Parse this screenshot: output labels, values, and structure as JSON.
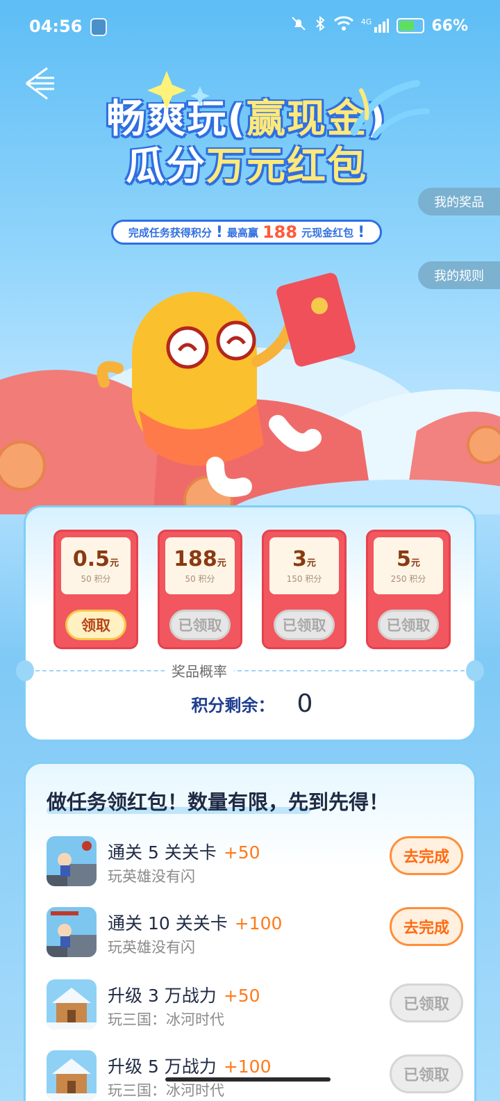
{
  "status_bar": {
    "time": "04:56",
    "network": "4G",
    "battery_percent": "66%",
    "battery_level": 0.66,
    "icons": [
      "mute-icon",
      "bluetooth-icon",
      "wifi-icon",
      "signal-icon",
      "battery-icon"
    ]
  },
  "hero": {
    "title_line1_a": "畅爽玩(",
    "title_line1_b": "赢现金",
    "title_line1_c": ")",
    "title_line2_a": "瓜分",
    "title_line2_b": "万元红包",
    "subtitle_a": "完成任务获得积分",
    "subtitle_b": "最高赢",
    "subtitle_num": "188",
    "subtitle_c": "元现金红包",
    "my_prizes": "我的奖品",
    "my_rules": "我的规则"
  },
  "prizes": [
    {
      "amount": "0.5",
      "unit": "元",
      "points": "50 积分",
      "button": "领取",
      "state": "active"
    },
    {
      "amount": "188",
      "unit": "元",
      "points": "50 积分",
      "button": "已领取",
      "state": "done"
    },
    {
      "amount": "3",
      "unit": "元",
      "points": "150 积分",
      "button": "已领取",
      "state": "done"
    },
    {
      "amount": "5",
      "unit": "元",
      "points": "250 积分",
      "button": "已领取",
      "state": "done"
    }
  ],
  "prize_probability_label": "奖品概率",
  "balance": {
    "label": "积分剩余：",
    "value": "0"
  },
  "tasks": {
    "heading": "做任务领红包！数量有限，先到先得！",
    "items": [
      {
        "title": "通关 5 关关卡",
        "points": "+50",
        "game": "玩英雄没有闪",
        "button": "去完成",
        "state": "go"
      },
      {
        "title": "通关 10 关关卡",
        "points": "+100",
        "game": "玩英雄没有闪",
        "button": "去完成",
        "state": "go"
      },
      {
        "title": "升级 3 万战力",
        "points": "+50",
        "game": "玩三国：冰河时代",
        "button": "已领取",
        "state": "done"
      },
      {
        "title": "升级 5 万战力",
        "points": "+100",
        "game": "玩三国：冰河时代",
        "button": "已领取",
        "state": "done"
      }
    ]
  },
  "colors": {
    "accent_orange": "#ff7a1a",
    "prize_red": "#f2565e",
    "brand_blue": "#2f6fe0"
  }
}
